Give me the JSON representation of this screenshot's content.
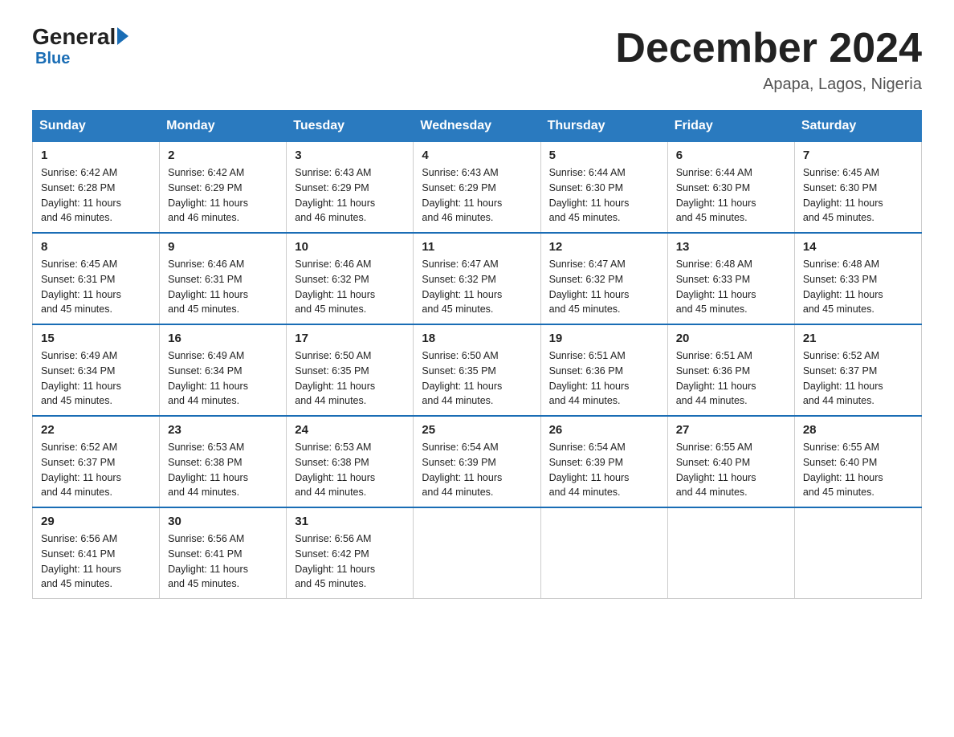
{
  "header": {
    "logo_main": "General",
    "logo_sub": "Blue",
    "month_title": "December 2024",
    "location": "Apapa, Lagos, Nigeria"
  },
  "days_of_week": [
    "Sunday",
    "Monday",
    "Tuesday",
    "Wednesday",
    "Thursday",
    "Friday",
    "Saturday"
  ],
  "weeks": [
    [
      {
        "day": "1",
        "sunrise": "6:42 AM",
        "sunset": "6:28 PM",
        "daylight": "11 hours and 46 minutes."
      },
      {
        "day": "2",
        "sunrise": "6:42 AM",
        "sunset": "6:29 PM",
        "daylight": "11 hours and 46 minutes."
      },
      {
        "day": "3",
        "sunrise": "6:43 AM",
        "sunset": "6:29 PM",
        "daylight": "11 hours and 46 minutes."
      },
      {
        "day": "4",
        "sunrise": "6:43 AM",
        "sunset": "6:29 PM",
        "daylight": "11 hours and 46 minutes."
      },
      {
        "day": "5",
        "sunrise": "6:44 AM",
        "sunset": "6:30 PM",
        "daylight": "11 hours and 45 minutes."
      },
      {
        "day": "6",
        "sunrise": "6:44 AM",
        "sunset": "6:30 PM",
        "daylight": "11 hours and 45 minutes."
      },
      {
        "day": "7",
        "sunrise": "6:45 AM",
        "sunset": "6:30 PM",
        "daylight": "11 hours and 45 minutes."
      }
    ],
    [
      {
        "day": "8",
        "sunrise": "6:45 AM",
        "sunset": "6:31 PM",
        "daylight": "11 hours and 45 minutes."
      },
      {
        "day": "9",
        "sunrise": "6:46 AM",
        "sunset": "6:31 PM",
        "daylight": "11 hours and 45 minutes."
      },
      {
        "day": "10",
        "sunrise": "6:46 AM",
        "sunset": "6:32 PM",
        "daylight": "11 hours and 45 minutes."
      },
      {
        "day": "11",
        "sunrise": "6:47 AM",
        "sunset": "6:32 PM",
        "daylight": "11 hours and 45 minutes."
      },
      {
        "day": "12",
        "sunrise": "6:47 AM",
        "sunset": "6:32 PM",
        "daylight": "11 hours and 45 minutes."
      },
      {
        "day": "13",
        "sunrise": "6:48 AM",
        "sunset": "6:33 PM",
        "daylight": "11 hours and 45 minutes."
      },
      {
        "day": "14",
        "sunrise": "6:48 AM",
        "sunset": "6:33 PM",
        "daylight": "11 hours and 45 minutes."
      }
    ],
    [
      {
        "day": "15",
        "sunrise": "6:49 AM",
        "sunset": "6:34 PM",
        "daylight": "11 hours and 45 minutes."
      },
      {
        "day": "16",
        "sunrise": "6:49 AM",
        "sunset": "6:34 PM",
        "daylight": "11 hours and 44 minutes."
      },
      {
        "day": "17",
        "sunrise": "6:50 AM",
        "sunset": "6:35 PM",
        "daylight": "11 hours and 44 minutes."
      },
      {
        "day": "18",
        "sunrise": "6:50 AM",
        "sunset": "6:35 PM",
        "daylight": "11 hours and 44 minutes."
      },
      {
        "day": "19",
        "sunrise": "6:51 AM",
        "sunset": "6:36 PM",
        "daylight": "11 hours and 44 minutes."
      },
      {
        "day": "20",
        "sunrise": "6:51 AM",
        "sunset": "6:36 PM",
        "daylight": "11 hours and 44 minutes."
      },
      {
        "day": "21",
        "sunrise": "6:52 AM",
        "sunset": "6:37 PM",
        "daylight": "11 hours and 44 minutes."
      }
    ],
    [
      {
        "day": "22",
        "sunrise": "6:52 AM",
        "sunset": "6:37 PM",
        "daylight": "11 hours and 44 minutes."
      },
      {
        "day": "23",
        "sunrise": "6:53 AM",
        "sunset": "6:38 PM",
        "daylight": "11 hours and 44 minutes."
      },
      {
        "day": "24",
        "sunrise": "6:53 AM",
        "sunset": "6:38 PM",
        "daylight": "11 hours and 44 minutes."
      },
      {
        "day": "25",
        "sunrise": "6:54 AM",
        "sunset": "6:39 PM",
        "daylight": "11 hours and 44 minutes."
      },
      {
        "day": "26",
        "sunrise": "6:54 AM",
        "sunset": "6:39 PM",
        "daylight": "11 hours and 44 minutes."
      },
      {
        "day": "27",
        "sunrise": "6:55 AM",
        "sunset": "6:40 PM",
        "daylight": "11 hours and 44 minutes."
      },
      {
        "day": "28",
        "sunrise": "6:55 AM",
        "sunset": "6:40 PM",
        "daylight": "11 hours and 45 minutes."
      }
    ],
    [
      {
        "day": "29",
        "sunrise": "6:56 AM",
        "sunset": "6:41 PM",
        "daylight": "11 hours and 45 minutes."
      },
      {
        "day": "30",
        "sunrise": "6:56 AM",
        "sunset": "6:41 PM",
        "daylight": "11 hours and 45 minutes."
      },
      {
        "day": "31",
        "sunrise": "6:56 AM",
        "sunset": "6:42 PM",
        "daylight": "11 hours and 45 minutes."
      },
      null,
      null,
      null,
      null
    ]
  ],
  "labels": {
    "sunrise": "Sunrise:",
    "sunset": "Sunset:",
    "daylight": "Daylight:"
  }
}
